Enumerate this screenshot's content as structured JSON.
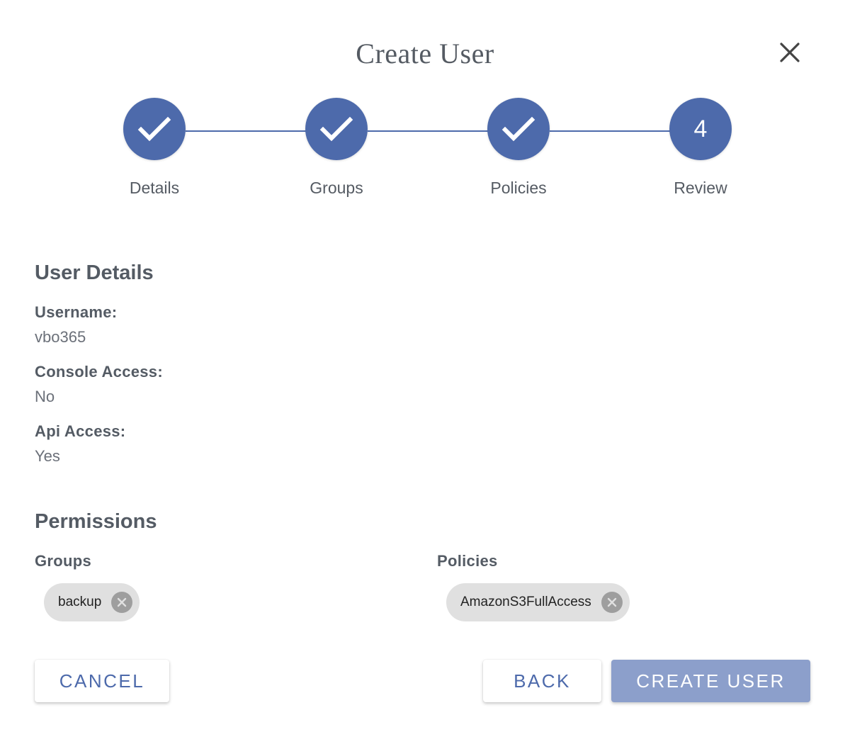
{
  "dialog": {
    "title": "Create User",
    "close_icon": "close-icon"
  },
  "stepper": {
    "steps": [
      {
        "label": "Details",
        "state": "completed",
        "icon": "check-icon"
      },
      {
        "label": "Groups",
        "state": "completed",
        "icon": "check-icon"
      },
      {
        "label": "Policies",
        "state": "completed",
        "icon": "check-icon"
      },
      {
        "label": "Review",
        "state": "active",
        "number": "4"
      }
    ],
    "accent_color": "#4d6aab"
  },
  "user_details": {
    "heading": "User Details",
    "username_label": "Username:",
    "username_value": "vbo365",
    "console_access_label": "Console Access:",
    "console_access_value": "No",
    "api_access_label": "Api Access:",
    "api_access_value": "Yes"
  },
  "permissions": {
    "heading": "Permissions",
    "groups_label": "Groups",
    "groups": [
      "backup"
    ],
    "policies_label": "Policies",
    "policies": [
      "AmazonS3FullAccess"
    ]
  },
  "actions": {
    "cancel_label": "CANCEL",
    "back_label": "BACK",
    "create_label": "CREATE USER",
    "create_color": "#8c9fcb"
  }
}
